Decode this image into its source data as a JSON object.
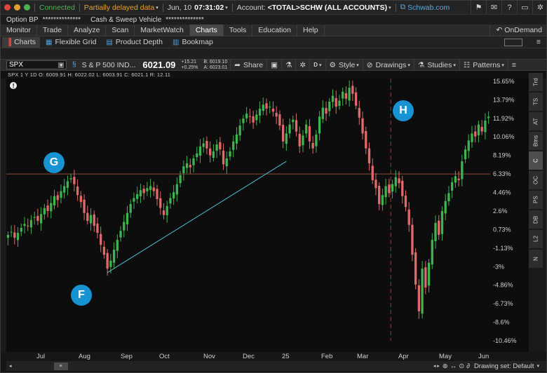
{
  "statusbar": {
    "connected": "Connected",
    "delayed": "Partially delayed data",
    "date": "Jun, 10",
    "time": "07:31:02",
    "account_label": "Account:",
    "account_value": "<TOTAL>SCHW (ALL ACCOUNTS)",
    "link": "Schwab.com",
    "dot_colors": [
      "#e0443a",
      "#e0a030",
      "#4fb050"
    ]
  },
  "bp": {
    "label": "Option BP",
    "value": "**************",
    "vehicle": "Cash & Sweep Vehicle",
    "vehicle_value": "**************"
  },
  "tabs": [
    "Monitor",
    "Trade",
    "Analyze",
    "Scan",
    "MarketWatch",
    "Charts",
    "Tools",
    "Education",
    "Help"
  ],
  "active_tab": "Charts",
  "ondemand": "OnDemand",
  "subtabs": [
    "Charts",
    "Flexible Grid",
    "Product Depth",
    "Bookmap"
  ],
  "toolbar": {
    "symbol": "SPX",
    "desc": "S & P 500 IND...",
    "price": "6021.09",
    "change": "+15.21",
    "change_pct": "+0.25%",
    "bid": "B: 6019.10",
    "ask": "A: 6023.01",
    "share": "Share",
    "d": "D",
    "style": "Style",
    "drawings": "Drawings",
    "studies": "Studies",
    "patterns": "Patterns"
  },
  "ohlc": "SPX 1 Y 1D  O: 6009.91  H: 6022.02  L: 6003.91  C: 6021.1  R: 12.11",
  "rail": [
    "Trd",
    "TS",
    "AT",
    "Btns",
    "C",
    "OC",
    "PS",
    "DB",
    "L2",
    "N"
  ],
  "rail_active": "C",
  "callouts": {
    "g": "G",
    "f": "F",
    "h": "H"
  },
  "months": [
    "Jul",
    "Aug",
    "Sep",
    "Oct",
    "Nov",
    "Dec",
    "25",
    "Feb",
    "Mar",
    "Apr",
    "May",
    "Jun"
  ],
  "drawing_set": "Drawing set: Default",
  "chart_data": {
    "type": "line",
    "y_axis_labels": [
      "15.65%",
      "13.79%",
      "11.92%",
      "10.06%",
      "8.19%",
      "6.33%",
      "4.46%",
      "2.6%",
      "0.73%",
      "-1.13%",
      "-3%",
      "-4.86%",
      "-6.73%",
      "-8.6%",
      "-10.46%"
    ],
    "ylim": [
      -10.46,
      15.65
    ],
    "series": [
      {
        "values": [
          0.2,
          0.5,
          -0.1,
          0.4,
          0.9,
          1.3,
          1.1,
          1.7,
          2.0,
          1.6,
          2.3,
          2.9,
          2.6,
          3.4,
          4.1,
          3.7,
          4.6,
          5.1,
          5.6,
          5.9,
          5.3,
          4.2,
          3.5,
          2.4,
          1.6,
          2.2,
          1.1,
          0.4,
          -0.8,
          -1.8,
          -3.2,
          -2.4,
          -1.3,
          -0.3,
          0.6,
          1.5,
          2.4,
          3.3,
          3.9,
          4.3,
          4.7,
          4.4,
          4.9,
          5.1,
          4.6,
          3.8,
          2.9,
          2.2,
          3.1,
          3.9,
          4.5,
          5.3,
          6.2,
          7.1,
          7.4,
          7.0,
          7.9,
          8.4,
          9.1,
          9.4,
          8.9,
          8.2,
          8.6,
          9.3,
          8.8,
          7.3,
          7.9,
          8.6,
          9.6,
          10.3,
          11.2,
          11.9,
          12.4,
          12.1,
          11.5,
          12.3,
          12.9,
          13.3,
          12.9,
          13.1,
          12.6,
          12.1,
          11.2,
          9.6,
          10.4,
          11.3,
          11.8,
          10.6,
          9.1,
          10.2,
          11.3,
          9.6,
          8.9,
          10.3,
          12.1,
          13.0,
          12.4,
          13.6,
          14.2,
          13.1,
          13.7,
          14.6,
          13.9,
          15.0,
          14.4,
          13.2,
          12.0,
          10.4,
          8.9,
          7.4,
          5.7,
          4.9,
          3.3,
          4.2,
          5.1,
          4.4,
          5.3,
          6.0,
          5.4,
          4.1,
          3.0,
          1.2,
          -1.8,
          -4.8,
          -7.5,
          -3.2,
          -5.1,
          -2.6,
          -0.3,
          1.4,
          0.2,
          2.6,
          3.6,
          4.4,
          5.5,
          6.1,
          5.7,
          7.6,
          8.8,
          9.7,
          10.4,
          10.1,
          11.3,
          10.6,
          11.7,
          12.1
        ]
      }
    ],
    "annotations": [
      "G",
      "F",
      "H"
    ],
    "ref_level_pct": 6.33
  }
}
